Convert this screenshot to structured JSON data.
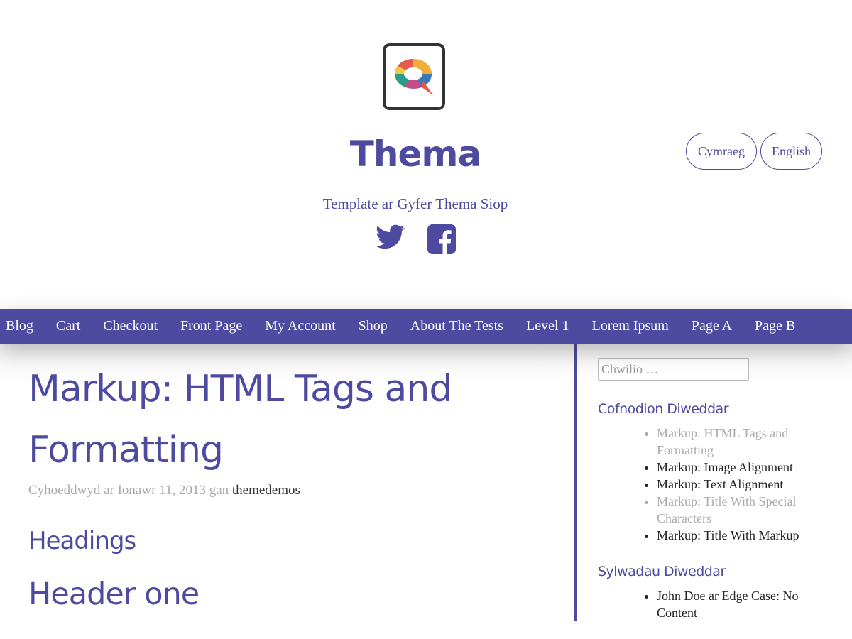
{
  "site": {
    "title": "Thema",
    "tagline": "Template ar Gyfer Thema Siop",
    "logo_icon": "speech-bubble-logo-icon"
  },
  "social": [
    {
      "name": "twitter-icon"
    },
    {
      "name": "facebook-icon"
    }
  ],
  "languages": {
    "cymraeg": "Cymraeg",
    "english": "English"
  },
  "nav": {
    "items": [
      "Blog",
      "Cart",
      "Checkout",
      "Front Page",
      "My Account",
      "Shop",
      "About The Tests",
      "Level 1",
      "Lorem Ipsum",
      "Page A",
      "Page B"
    ]
  },
  "post": {
    "title_line1": "Markup: HTML Tags and",
    "title_line2": "Formatting",
    "meta_prefix": "Cyhoeddwyd ar Ionawr 11, 2013 gan ",
    "author": "themedemos",
    "heading_headings": "Headings",
    "heading_one": "Header one"
  },
  "sidebar": {
    "search_placeholder": "Chwilio …",
    "recent_posts_title": "Cofnodion Diweddar",
    "recent_posts": [
      "Markup: HTML Tags and Formatting",
      "Markup: Image Alignment",
      "Markup: Text Alignment",
      "Markup: Title With Special Characters",
      "Markup: Title With Markup"
    ],
    "recent_comments_title": "Sylwadau Diweddar",
    "recent_comments": [
      "John Doe ar Edge Case: No Content"
    ]
  },
  "colors": {
    "brand": "#4e4aa0",
    "muted_text": "#aaaaaa"
  }
}
